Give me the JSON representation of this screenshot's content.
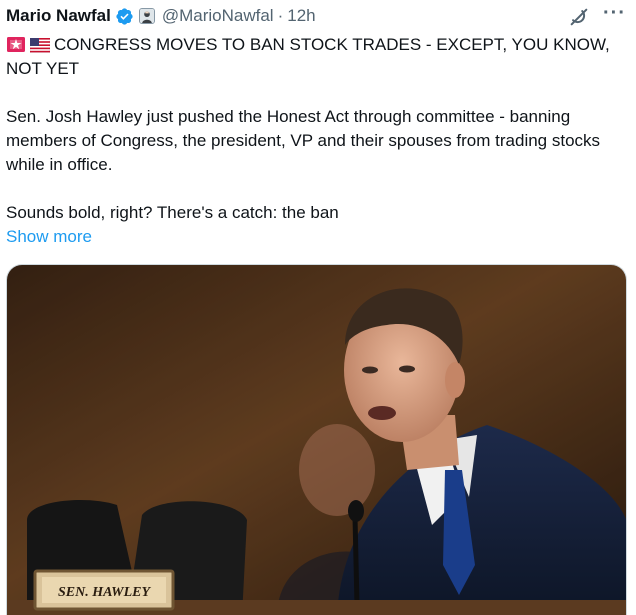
{
  "tweet": {
    "author_name": "Mario Nawfal",
    "handle": "@MarioNawfal",
    "separator": "·",
    "time": "12h",
    "more_icon_glyph": "···",
    "headline_icons": [
      "siren-icon",
      "us-flag-icon"
    ],
    "headline": "CONGRESS MOVES TO BAN STOCK TRADES - EXCEPT, YOU KNOW, NOT YET",
    "paragraph_1": "Sen. Josh Hawley just pushed the Honest Act through committee - banning members of Congress, the president, VP and their spouses from trading stocks while in office.",
    "paragraph_2": "Sounds bold, right? There's a catch: the ban",
    "show_more": "Show more",
    "icons": {
      "verified": "verified-badge-icon",
      "affiliation": "affiliation-avatar-icon",
      "grok": "grok-icon",
      "more": "more-options-icon"
    },
    "colors": {
      "link": "#1d9bf0",
      "secondary_text": "#536471",
      "verified": "#1d9bf0"
    }
  },
  "media": {
    "nameplate_text": "SEN. HAWLEY"
  }
}
